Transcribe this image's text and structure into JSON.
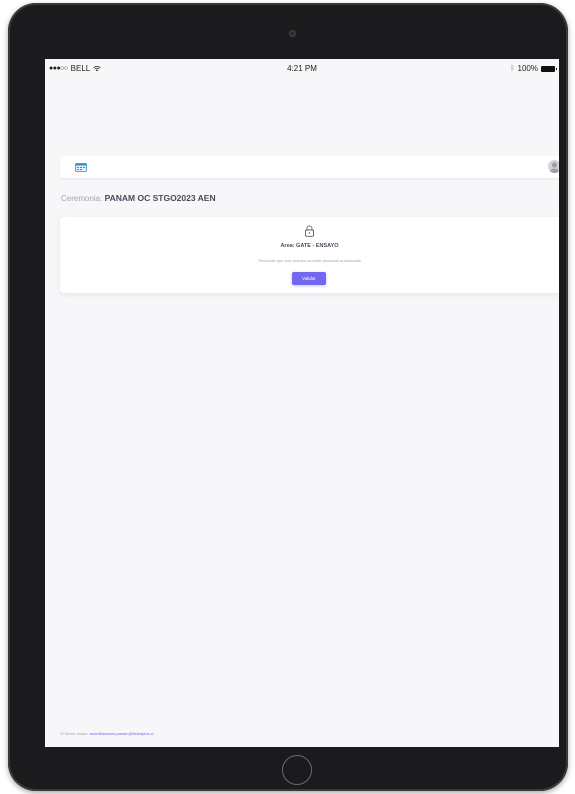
{
  "status_bar": {
    "carrier": "BELL",
    "signal": "●●●○○",
    "time": "4:21 PM",
    "battery": "100%",
    "icons": [
      "wifi-icon",
      "bluetooth-icon",
      "battery-icon"
    ]
  },
  "header": {
    "logo_icon": "calendar-logo-icon",
    "avatar_icon": "user-avatar-icon",
    "avatar_status_color": "#28c76f"
  },
  "ceremony": {
    "label": "Ceremonia:",
    "value": "PANAM OC STGO2023 AEN"
  },
  "area_card": {
    "icon": "lock-icon",
    "title": "Area: GATE - ENSAYO",
    "message": "Recuerda que solo pueden acceder personas autorizadas",
    "button_label": "Validar"
  },
  "footer": {
    "prefix": "Si tienes dudas:",
    "email": "acreditaciones.panam@ticketplus.cl"
  },
  "colors": {
    "accent": "#7367f0",
    "background": "#f7f6f9",
    "text_dark": "#4b4b5a",
    "text_muted": "#a5a3ae",
    "device_frame": "#1b1b1d"
  }
}
